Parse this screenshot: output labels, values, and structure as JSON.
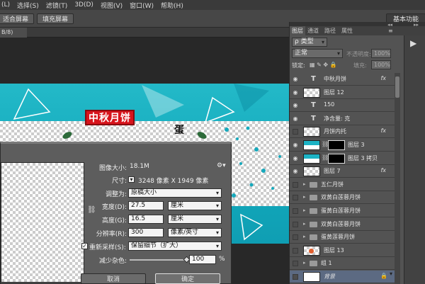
{
  "menubar": {
    "items": [
      "(L)",
      "选择(S)",
      "滤镜(T)",
      "3D(D)",
      "视图(V)",
      "窗口(W)",
      "帮助(H)"
    ]
  },
  "toolbar": {
    "fit_screen": "适合屏幕",
    "fill_screen": "填充屏幕",
    "basic_function": "基本功能"
  },
  "document_tab": {
    "label": "B/8)"
  },
  "banner": {
    "title": "中秋月饼",
    "partial_text": "蛋"
  },
  "image_size_dialog": {
    "image_size_label": "图像大小:",
    "image_size_value": "18.1M",
    "dimensions_label": "尺寸:",
    "dimensions_value": "3248 像素 X 1949 像素",
    "fit_to_label": "调整为:",
    "fit_to_value": "原稿大小",
    "width_label": "宽度(D):",
    "width_value": "27.5",
    "width_unit": "厘米",
    "height_label": "高度(G):",
    "height_value": "16.5",
    "height_unit": "厘米",
    "resolution_label": "分辨率(R):",
    "resolution_value": "300",
    "resolution_unit": "像素/英寸",
    "resample_label": "重新采样(S):",
    "resample_value": "保留细节（扩大）",
    "noise_label": "减少杂色:",
    "noise_value": "100",
    "noise_unit": "%",
    "noise_level": 1.0,
    "cancel": "取消",
    "ok": "确定"
  },
  "layers_panel": {
    "tabs": [
      "图层",
      "通道",
      "路径",
      "属性"
    ],
    "filter_kind": "ρ 类型",
    "blend_mode": "正常",
    "opacity_label": "不透明度:",
    "opacity_value": "100%",
    "lock_label": "锁定:",
    "fill_label": "填充:",
    "fill_value": "100%",
    "layers": [
      {
        "name": "中秋月饼",
        "type": "text",
        "fx": "fx"
      },
      {
        "name": "图层 12",
        "type": "pixel",
        "fx": ""
      },
      {
        "name": "150",
        "type": "text",
        "fx": ""
      },
      {
        "name": "净含量: 克",
        "type": "text",
        "fx": ""
      },
      {
        "name": "月饼内托",
        "type": "pixel",
        "fx": "fx"
      },
      {
        "name": "图层 3",
        "type": "masked",
        "fx": ""
      },
      {
        "name": "图层 3 拷贝",
        "type": "masked",
        "fx": ""
      },
      {
        "name": "图层 7",
        "type": "pixel",
        "fx": "fx"
      },
      {
        "name": "五仁月饼",
        "type": "group",
        "fx": ""
      },
      {
        "name": "双黄白莲蓉月饼",
        "type": "group",
        "fx": ""
      },
      {
        "name": "蛋黄白莲蓉月饼",
        "type": "group",
        "fx": ""
      },
      {
        "name": "双黄白莲蓉月饼",
        "type": "group",
        "fx": ""
      },
      {
        "name": "蛋黄莲蓉月饼",
        "type": "group",
        "fx": ""
      },
      {
        "name": "图层 13",
        "type": "pixel",
        "fx": ""
      },
      {
        "name": "组 1",
        "type": "group",
        "fx": ""
      },
      {
        "name": "背景",
        "type": "background",
        "fx": ""
      }
    ]
  },
  "colors": {
    "accent": "#d8141c",
    "teal": "#19b0c2",
    "selection": "#5c6a82"
  }
}
